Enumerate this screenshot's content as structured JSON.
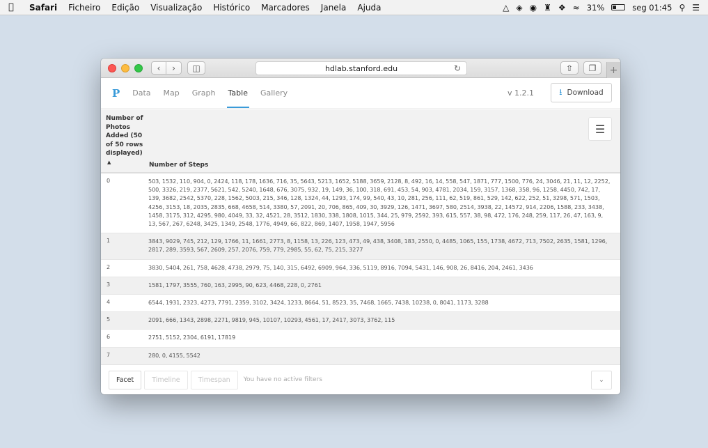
{
  "menubar": {
    "apple_icon": "apple-logo-icon",
    "items": [
      "Safari",
      "Ficheiro",
      "Edição",
      "Visualização",
      "Histórico",
      "Marcadores",
      "Janela",
      "Ajuda"
    ],
    "battery": "31%",
    "clock": "seg 01:45"
  },
  "browser": {
    "url": "hdlab.stanford.edu"
  },
  "app": {
    "logo": "P",
    "nav": [
      "Data",
      "Map",
      "Graph",
      "Table",
      "Gallery"
    ],
    "active_nav": "Table",
    "version": "v 1.2.1",
    "download_label": "Download",
    "accent_color": "#3a9bd9"
  },
  "table": {
    "col1_header": "Number of Photos Added (50 of 50 rows displayed)",
    "col2_header": "Number of Steps",
    "rows": [
      {
        "key": "0",
        "value": "503, 1532, 110, 904, 0, 2424, 118, 178, 1636, 716, 35, 5643, 5213, 1652, 5188, 3659, 2128, 8, 492, 16, 14, 558, 547, 1871, 777, 1500, 776, 24, 3046, 21, 11, 12, 2252, 500, 3326, 219, 2377, 5621, 542, 5240, 1648, 676, 3075, 932, 19, 149, 36, 100, 318, 691, 453, 54, 903, 4781, 2034, 159, 3157, 1368, 358, 96, 1258, 4450, 742, 17, 139, 3682, 2542, 5370, 228, 1562, 5003, 215, 346, 128, 1324, 44, 1293, 174, 99, 540, 43, 10, 281, 256, 111, 62, 519, 861, 529, 142, 622, 252, 51, 3298, 571, 1503, 4256, 3153, 18, 2035, 2835, 668, 4658, 514, 3380, 57, 2091, 20, 706, 865, 409, 30, 3929, 126, 1471, 3697, 580, 2514, 3938, 22, 14572, 914, 2206, 1588, 233, 3438, 1458, 3175, 312, 4295, 980, 4049, 33, 32, 4521, 28, 3512, 1830, 338, 1808, 1015, 344, 25, 979, 2592, 393, 615, 557, 38, 98, 472, 176, 248, 259, 117, 26, 47, 163, 9, 13, 567, 267, 6248, 3425, 1349, 2548, 1776, 4949, 66, 822, 869, 1407, 1958, 1947, 5956"
      },
      {
        "key": "1",
        "value": "3843, 9029, 745, 212, 129, 1766, 11, 1661, 2773, 8, 1158, 13, 226, 123, 473, 49, 438, 3408, 183, 2550, 0, 4485, 1065, 155, 1738, 4672, 713, 7502, 2635, 1581, 1296, 2817, 289, 3593, 567, 2609, 257, 2076, 759, 779, 2985, 55, 62, 75, 215, 3277"
      },
      {
        "key": "2",
        "value": "3830, 5404, 261, 758, 4628, 4738, 2979, 75, 140, 315, 6492, 6909, 964, 336, 5119, 8916, 7094, 5431, 146, 908, 26, 8416, 204, 2461, 3436"
      },
      {
        "key": "3",
        "value": "1581, 1797, 3555, 760, 163, 2995, 90, 623, 4468, 228, 0, 2761"
      },
      {
        "key": "4",
        "value": "6544, 1931, 2323, 4273, 7791, 2359, 3102, 3424, 1233, 8664, 51, 8523, 35, 7468, 1665, 7438, 10238, 0, 8041, 1173, 3288"
      },
      {
        "key": "5",
        "value": "2091, 666, 1343, 2898, 2271, 9819, 945, 10107, 10293, 4561, 17, 2417, 3073, 3762, 115"
      },
      {
        "key": "6",
        "value": "2751, 5152, 2304, 6191, 17819"
      },
      {
        "key": "7",
        "value": "280, 0, 4155, 5542"
      }
    ]
  },
  "bottombar": {
    "facet": "Facet",
    "timeline": "Timeline",
    "timespan": "Timespan",
    "filters_text": "You have no active filters"
  }
}
